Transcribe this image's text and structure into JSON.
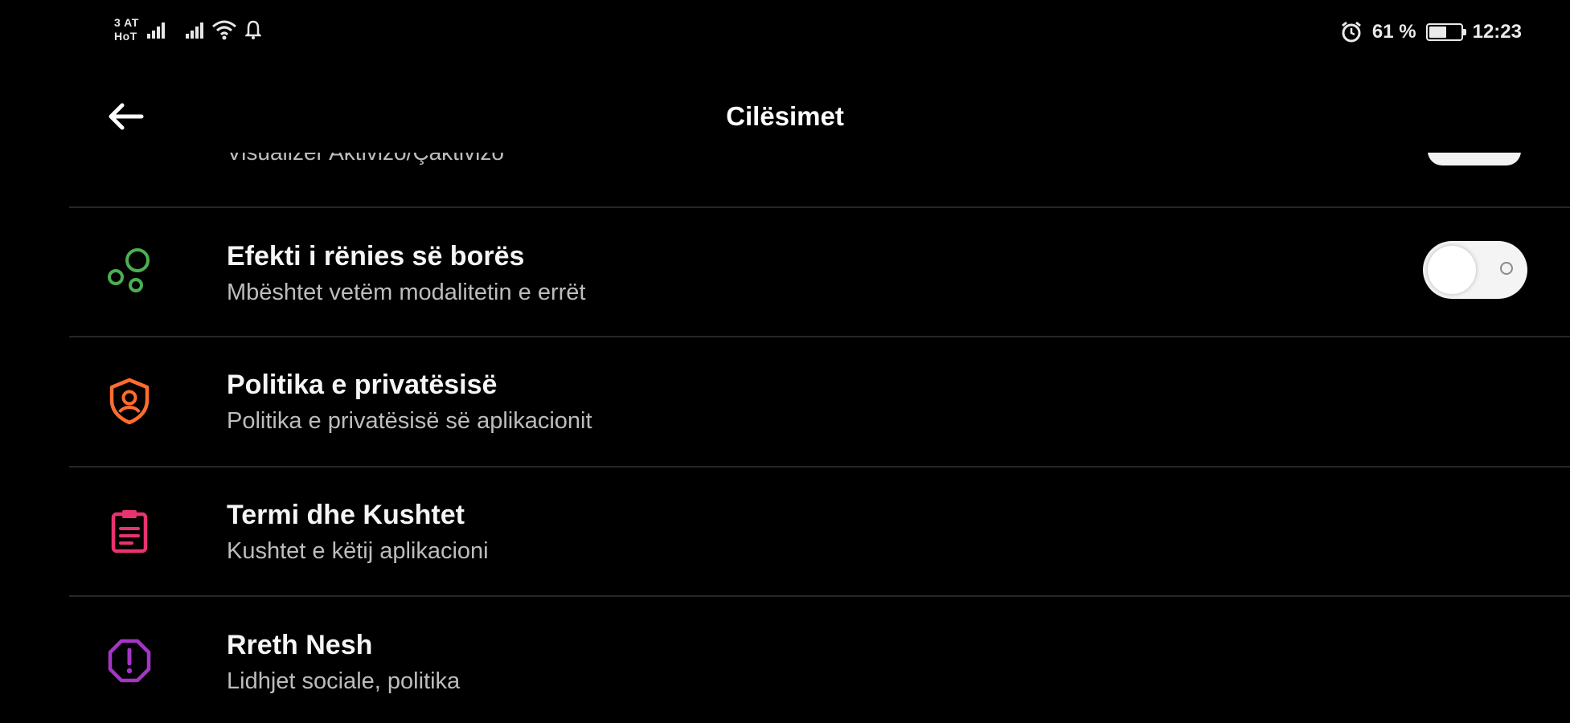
{
  "status_bar": {
    "carrier_line1": "3 AT",
    "carrier_line2": "HoT",
    "battery_percent": "61 %",
    "battery_level": 0.61,
    "time": "12:23",
    "icons": [
      "signal-icon",
      "signal-icon",
      "wifi-icon",
      "notification-icon",
      "alarm-icon",
      "battery-icon"
    ]
  },
  "app_bar": {
    "title": "Cilësimet",
    "back_icon": "arrow-left-icon"
  },
  "partial_item": {
    "subtitle": "Visualizer Aktivizo/Çaktivizo"
  },
  "items": [
    {
      "title": "Efekti i rënies së borës",
      "subtitle": "Mbështet vetëm modalitetin e errët",
      "icon": "bubbles-icon",
      "color": "#4caf50",
      "toggle": true,
      "toggle_on": false
    },
    {
      "title": "Politika e privatësisë",
      "subtitle": "Politika e privatësisë së aplikacionit",
      "icon": "shield-user-icon",
      "color": "#ff6d2d"
    },
    {
      "title": "Termi dhe Kushtet",
      "subtitle": "Kushtet e këtij aplikacioni",
      "icon": "clipboard-icon",
      "color": "#e8336f"
    },
    {
      "title": "Rreth Nesh",
      "subtitle": "Lidhjet sociale, politika",
      "icon": "info-octagon-icon",
      "color": "#a535c8"
    }
  ]
}
